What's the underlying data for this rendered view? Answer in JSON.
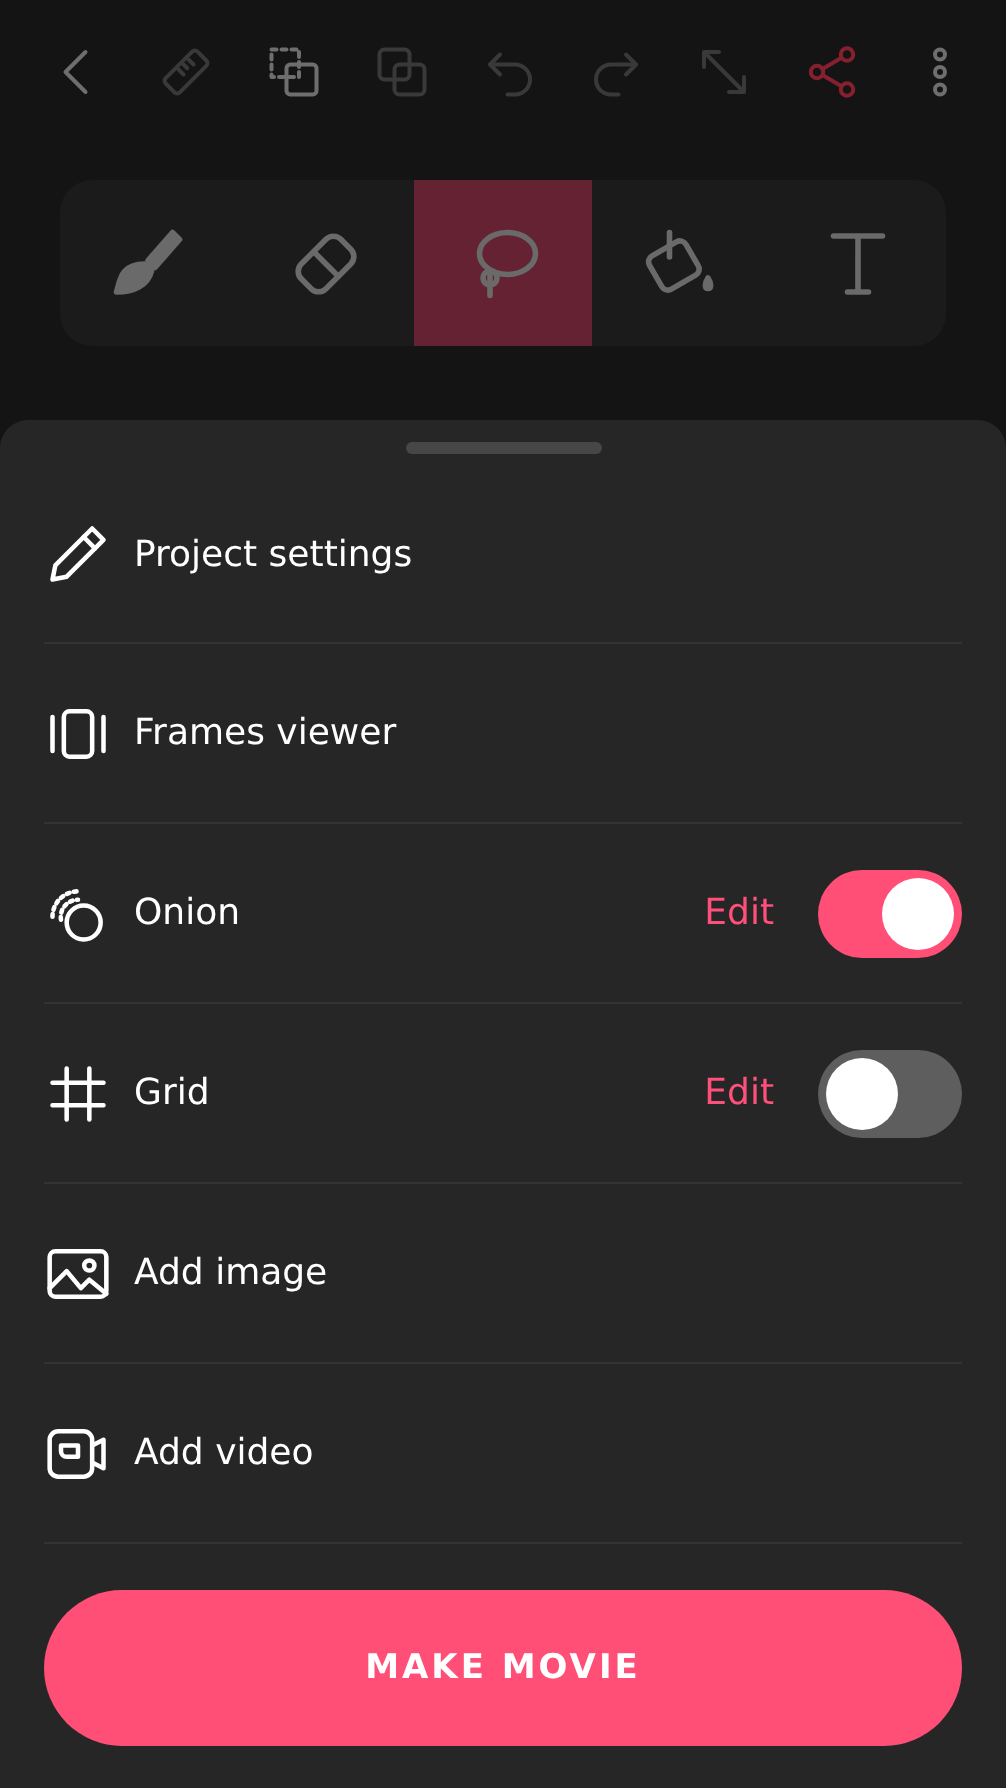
{
  "toolbar": [
    {
      "disabled": false,
      "highlighted": false
    },
    {
      "disabled": true,
      "highlighted": false
    },
    {
      "disabled": false,
      "highlighted": false
    },
    {
      "disabled": true,
      "highlighted": false
    },
    {
      "disabled": true,
      "highlighted": false
    },
    {
      "disabled": true,
      "highlighted": false
    },
    {
      "disabled": true,
      "highlighted": false
    },
    {
      "disabled": false,
      "highlighted": true
    },
    {
      "disabled": false,
      "highlighted": false
    }
  ],
  "tools": [
    {
      "selected": false
    },
    {
      "selected": false
    },
    {
      "selected": true
    },
    {
      "selected": false
    },
    {
      "selected": false
    }
  ],
  "menu": [
    {
      "kind": "link",
      "label": "Project settings"
    },
    {
      "kind": "link",
      "label": "Frames viewer"
    },
    {
      "kind": "toggle",
      "label": "Onion",
      "action": "Edit",
      "on": true
    },
    {
      "kind": "toggle",
      "label": "Grid",
      "action": "Edit",
      "on": false
    },
    {
      "kind": "link",
      "label": "Add image"
    },
    {
      "kind": "link",
      "label": "Add video"
    }
  ],
  "primary_button": "MAKE MOVIE"
}
